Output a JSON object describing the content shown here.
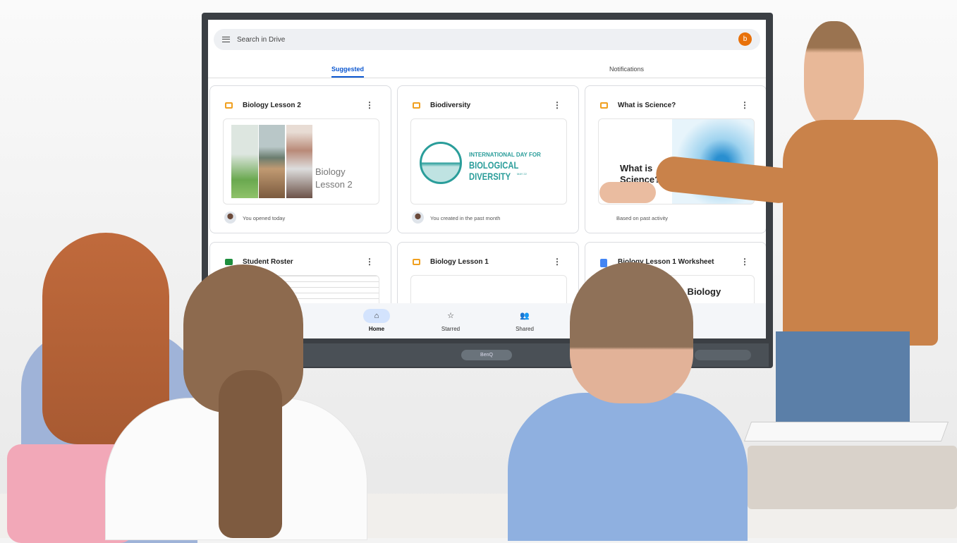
{
  "drive": {
    "search_placeholder": "Search in Drive",
    "account_initial": "b",
    "tabs": [
      {
        "label": "Suggested",
        "active": true
      },
      {
        "label": "Notifications",
        "active": false
      }
    ],
    "cards": [
      {
        "title": "Biology Lesson 2",
        "type": "slides",
        "icon": "slides-icon",
        "thumb_text": "Biology Lesson 2",
        "footer": "You opened today"
      },
      {
        "title": "Biodiversity",
        "type": "slides",
        "icon": "slides-icon",
        "thumb_text_1": "INTERNATIONAL DAY FOR",
        "thumb_text_2": "BIOLOGICAL DIVERSITY",
        "thumb_text_3": "MAY 22",
        "footer": "You created in the past month"
      },
      {
        "title": "What is Science?",
        "type": "slides",
        "icon": "slides-icon",
        "thumb_text": "What is Science?",
        "footer": "Based on past activity"
      },
      {
        "title": "Student Roster",
        "type": "sheets",
        "icon": "sheets-icon"
      },
      {
        "title": "Biology Lesson 1",
        "type": "slides",
        "icon": "slides-icon"
      },
      {
        "title": "Biology Lesson 1 Worksheet",
        "type": "docs",
        "icon": "docs-icon",
        "thumb_text": "o Biology"
      }
    ],
    "bottom_nav": [
      {
        "label": "Home",
        "icon": "home-icon",
        "active": true
      },
      {
        "label": "Starred",
        "icon": "star-icon"
      },
      {
        "label": "Shared",
        "icon": "shared-icon"
      }
    ]
  },
  "monitor": {
    "brand": "BenQ"
  },
  "colors": {
    "accent": "#0b57d0",
    "slides": "#f0a020",
    "sheets": "#1e8e3e",
    "docs": "#4285f4",
    "avatar": "#e8710a",
    "sweater": "#c9824a"
  }
}
